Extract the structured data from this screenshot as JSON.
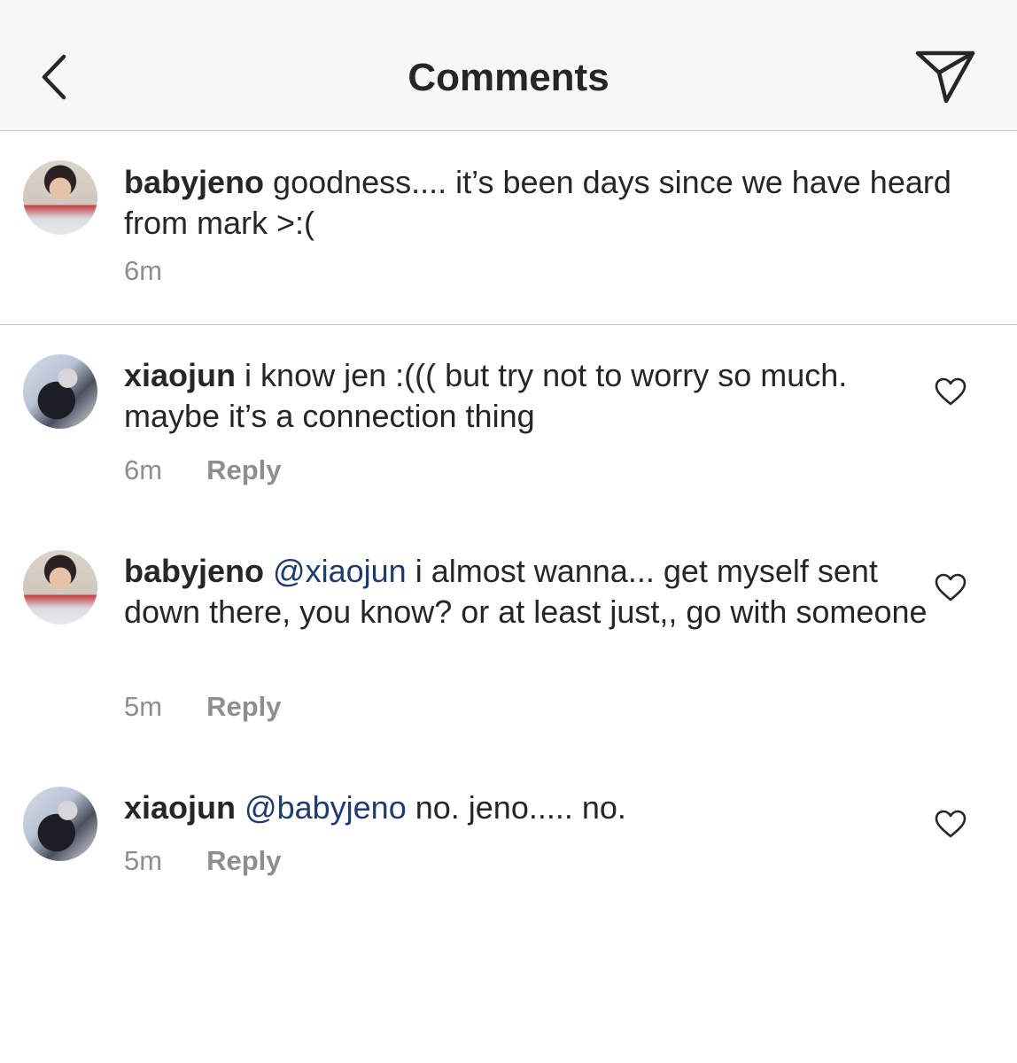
{
  "header": {
    "title": "Comments",
    "back_icon": "chevron-left-icon",
    "share_icon": "paper-plane-icon"
  },
  "caption": {
    "username": "babyjeno",
    "text": "goodness.... it’s been days since we have heard from mark >:(",
    "time": "6m"
  },
  "comments": [
    {
      "username": "xiaojun",
      "mention": "",
      "text": "i know jen :((( but try not to worry so much. maybe it’s a connection thing",
      "time": "6m",
      "reply_label": "Reply"
    },
    {
      "username": "babyjeno",
      "mention": "@xiaojun",
      "text": "i almost wanna... get myself sent down there, you know? or at least just,, go with someone",
      "time": "5m",
      "reply_label": "Reply"
    },
    {
      "username": "xiaojun",
      "mention": "@babyjeno",
      "text": "no. jeno..... no.",
      "time": "5m",
      "reply_label": "Reply"
    }
  ],
  "colors": {
    "header_bg": "#f7f7f7",
    "text": "#262626",
    "meta": "#8e8e8e",
    "mention": "#1e3a6e",
    "divider": "#c7c7c7"
  }
}
